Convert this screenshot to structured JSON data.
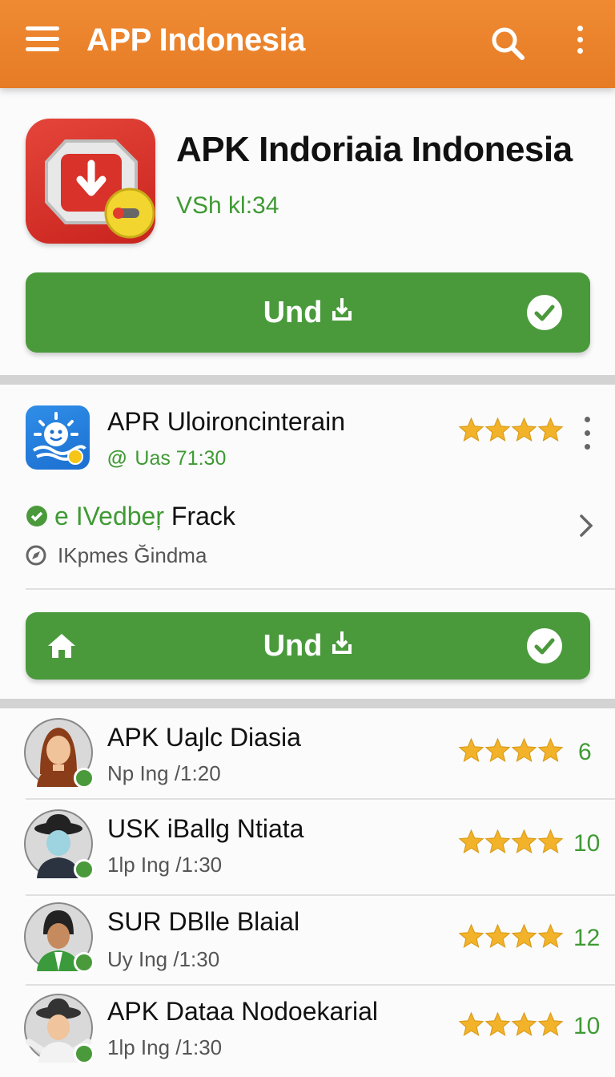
{
  "appbar": {
    "title": "APP Indonesia",
    "menu_icon": "hamburger-menu-icon",
    "search_icon": "search-icon",
    "more_icon": "more-vert-icon",
    "color": "#e67c25"
  },
  "featured": {
    "title": "APK Indoriaia Indonesia",
    "version": "VSh kl:34",
    "icon": "download-app-icon",
    "button_label": "Und",
    "button_color": "#4a9a3c"
  },
  "detail": {
    "title": "APR Uloironcinterain",
    "subtitle": "Uas 71:30",
    "rating": 4.5,
    "feature_title_green": "e IVedbeŗ",
    "feature_title": "Frack",
    "feature_sub": "IKpmes Ğindma",
    "button_label": "Und"
  },
  "list": [
    {
      "title": "APK Uaȷlc Diasia",
      "subtitle": "Np Ing /1:20",
      "rating": 4.5,
      "count": "6"
    },
    {
      "title": "USK iBallg Ntiata",
      "subtitle": "1lp Ing /1:30",
      "rating": 4.5,
      "count": "10"
    },
    {
      "title": "SUR DBlle Blaial",
      "subtitle": "Uy Ing /1:30",
      "rating": 4.5,
      "count": "12"
    },
    {
      "title": "APK Dataa Nodoekarial",
      "subtitle": "1lp Ing /1:30",
      "rating": 4.5,
      "count": "10"
    }
  ]
}
